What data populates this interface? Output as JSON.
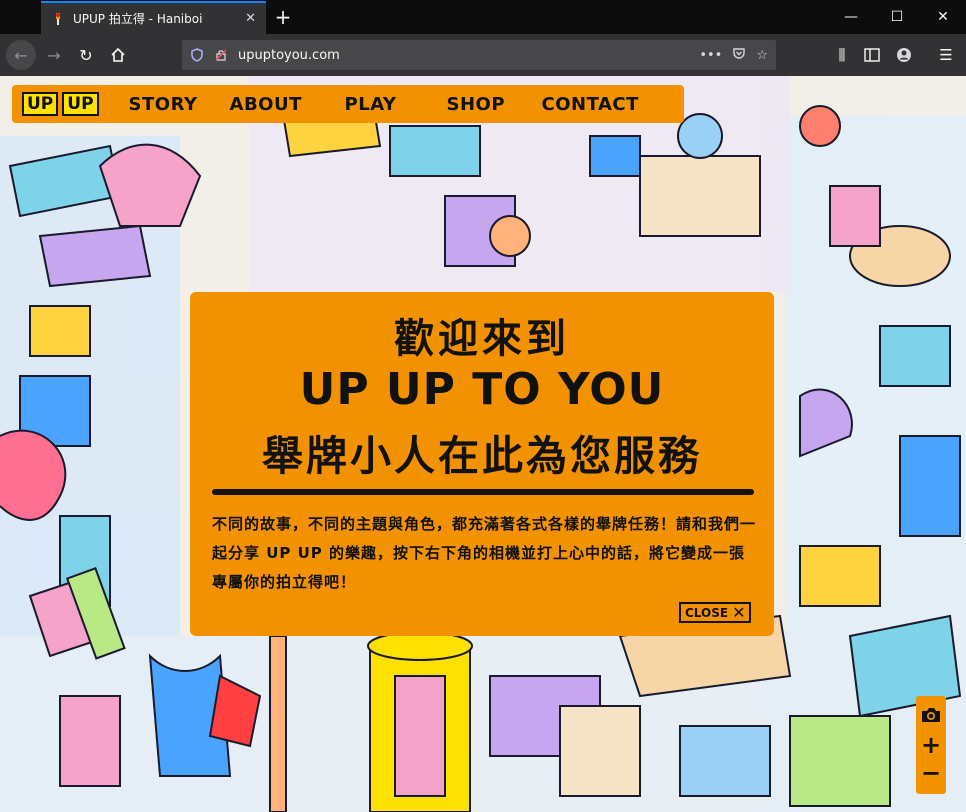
{
  "browser": {
    "tab_title": "UPUP 拍立得 - Haniboi",
    "tab_close_icon": "close-icon",
    "new_tab_icon": "plus-icon",
    "url": "upuptoyou.com",
    "window_controls": [
      "minimize-icon",
      "maximize-icon",
      "close-icon"
    ]
  },
  "site": {
    "logo": [
      "UP",
      "UP"
    ],
    "menu": [
      "STORY",
      "ABOUT",
      "PLAY",
      "SHOP",
      "CONTACT"
    ]
  },
  "modal": {
    "line1": "歡迎來到",
    "line2": "UP UP TO YOU",
    "line3": "舉牌小人在此為您服務",
    "paragraph": "不同的故事，不同的主題與角色，都充滿著各式各樣的舉牌任務！請和我們一起分享 UP UP 的樂趣，按下右下角的相機並打上心中的話，將它變成一張專屬你的拍立得吧！",
    "close_label": "CLOSE",
    "close_icon": "x-icon"
  },
  "tools": {
    "camera_icon": "camera-icon",
    "zoom_in_label": "+",
    "zoom_out_label": "−"
  },
  "colors": {
    "brand_orange": "#f39200",
    "logo_yellow": "#ffe100",
    "ink": "#111111",
    "chrome_dark": "#0c0c0d",
    "chrome_bar": "#323234",
    "tab_accent": "#0a84ff"
  }
}
